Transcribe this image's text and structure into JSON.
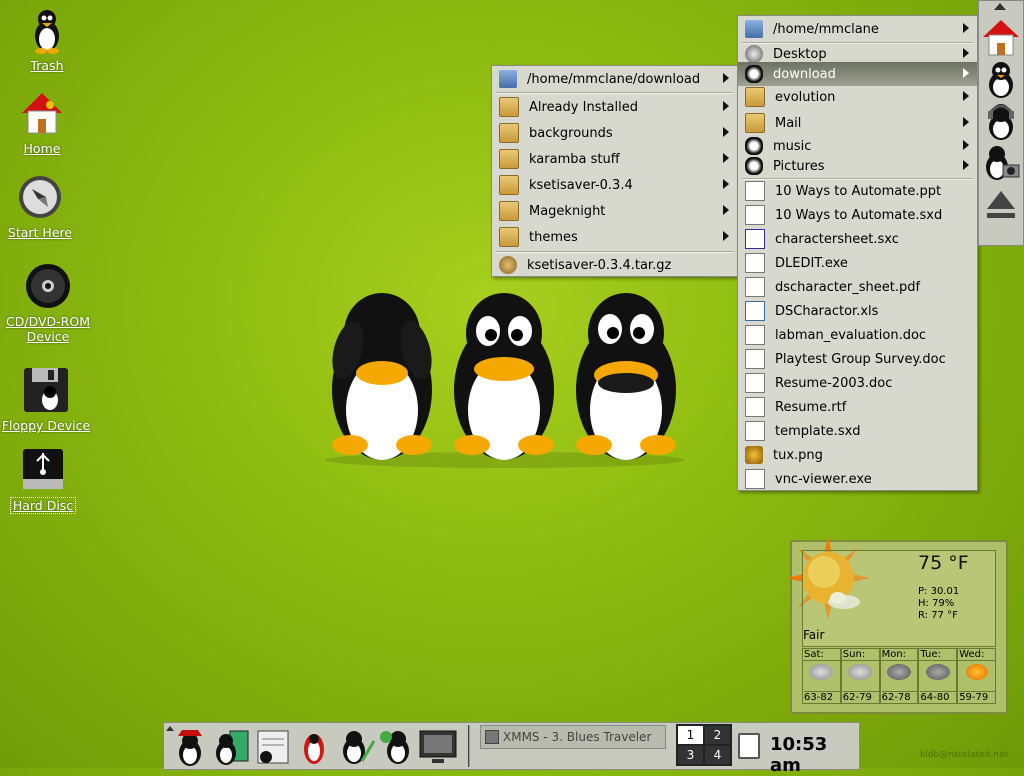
{
  "desktop_icons": [
    {
      "id": "trash",
      "label": "Trash",
      "icon": "tux-trash-icon"
    },
    {
      "id": "home",
      "label": "Home",
      "icon": "home-icon"
    },
    {
      "id": "start",
      "label": "Start Here",
      "icon": "start-here-icon"
    },
    {
      "id": "cdrom",
      "label": "CD/DVD-ROM Device",
      "icon": "cd-icon"
    },
    {
      "id": "floppy",
      "label": "Floppy Device",
      "icon": "floppy-icon"
    },
    {
      "id": "hdd",
      "label": "Hard Disc",
      "icon": "hard-disc-icon"
    }
  ],
  "menu_download": {
    "header": "/home/mmclane/download",
    "items": [
      "Already Installed",
      "backgrounds",
      "karamba stuff",
      "ksetisaver-0.3.4",
      "Mageknight",
      "themes"
    ],
    "files": [
      "ksetisaver-0.3.4.tar.gz"
    ]
  },
  "menu_home": {
    "header": "/home/mmclane",
    "folders": [
      "Desktop",
      "download",
      "evolution",
      "Mail",
      "music",
      "Pictures"
    ],
    "selected": "download",
    "files": [
      "10 Ways to Automate.ppt",
      "10 Ways to Automate.sxd",
      "charactersheet.sxc",
      "DLEDIT.exe",
      "dscharacter_sheet.pdf",
      "DSCharactor.xls",
      "labman_evaluation.doc",
      "Playtest Group Survey.doc",
      "Resume-2003.doc",
      "Resume.rtf",
      "template.sxd",
      "tux.png",
      "vnc-viewer.exe"
    ]
  },
  "weather": {
    "temp": "75 °F",
    "pressure": "P: 30.01",
    "humidity": "H: 79%",
    "real_feel": "R: 77 °F",
    "condition": "Fair",
    "forecast": [
      {
        "day": "Sat:",
        "range": "63-82"
      },
      {
        "day": "Sun:",
        "range": "62-79"
      },
      {
        "day": "Mon:",
        "range": "62-78"
      },
      {
        "day": "Tue:",
        "range": "64-80"
      },
      {
        "day": "Wed:",
        "range": "59-79"
      }
    ]
  },
  "taskbar": {
    "task": "XMMS - 3. Blues Traveler",
    "desktops": [
      "1",
      "2",
      "3",
      "4"
    ],
    "active_desktop": "1",
    "clock": "10:53 am"
  },
  "watermark": "kldb@nstelated.net",
  "colors": {
    "menu_bg": "#d7d9cf",
    "selected_item": "#7b7f6e",
    "desktop_green": "#8dbb10"
  }
}
